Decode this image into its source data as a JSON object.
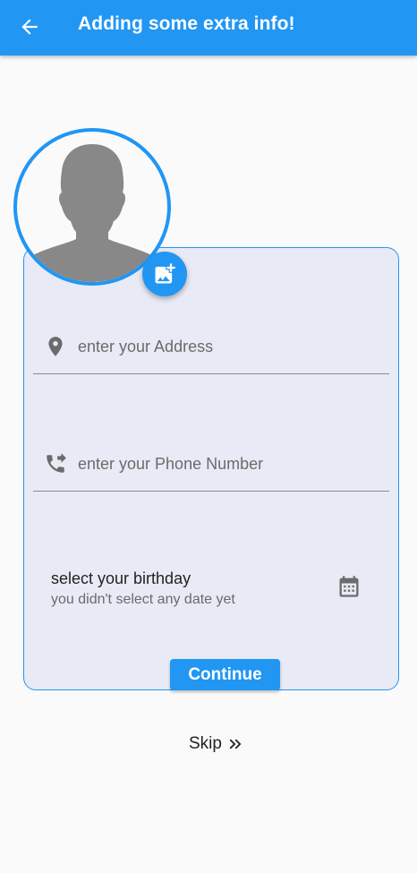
{
  "appbar": {
    "title": "Adding some extra info!"
  },
  "colors": {
    "primary": "#2196f3",
    "card_background": "#e8eaf6",
    "avatar_silhouette": "#888888"
  },
  "form": {
    "address": {
      "placeholder": "enter your Address",
      "value": "",
      "icon": "location-pin-icon"
    },
    "phone": {
      "placeholder": "enter your Phone Number",
      "value": "",
      "icon": "phone-forwarded-icon"
    },
    "birthday": {
      "title": "select your birthday",
      "subtitle": "you didn't select any date yet",
      "icon": "calendar-icon"
    },
    "continue_label": "Continue"
  },
  "avatar": {
    "icon": "person-silhouette-icon",
    "add_photo_icon": "add-photo-icon"
  },
  "skip": {
    "label": "Skip",
    "icon": "double-chevron-right-icon"
  }
}
